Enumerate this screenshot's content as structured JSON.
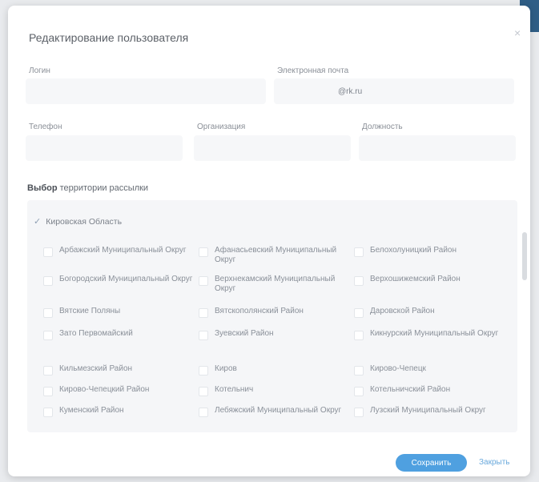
{
  "dialog": {
    "title": "Редактирование пользователя",
    "close": "×"
  },
  "form": {
    "login_label": "Логин",
    "email_label": "Электронная почта",
    "email_value": "@rk.ru",
    "phone_label": "Телефон",
    "org_label": "Организация",
    "position_label": "Должность"
  },
  "section": {
    "title_bold": "Выбор",
    "title_rest": "территории рассылки"
  },
  "region": {
    "name": "Кировская Область"
  },
  "districts": [
    "Арбажский Муниципальный Округ",
    "Афанасьевский Муниципальный Округ",
    "Белохолуницкий Район",
    "Богородский Муниципальный Округ",
    "Верхнекамский Муниципальный Округ",
    "Верхошижемский Район",
    "Вятские Поляны",
    "Вятскополянский Район",
    "Даровской Район",
    "Зато Первомайский",
    "Зуевский Район",
    "Кикнурский Муниципальный Округ",
    "Кильмезский Район",
    "Киров",
    "Кирово-Чепецк",
    "Кирово-Чепецкий Район",
    "Котельнич",
    "Котельничский Район",
    "Куменский Район",
    "Лебяжский Муниципальный Округ",
    "Лузский Муниципальный Округ"
  ],
  "buttons": {
    "save": "Сохранить",
    "cancel": "Закрыть"
  },
  "colors": {
    "accent": "#4fa0e0",
    "panel": "#f5f6f8"
  }
}
